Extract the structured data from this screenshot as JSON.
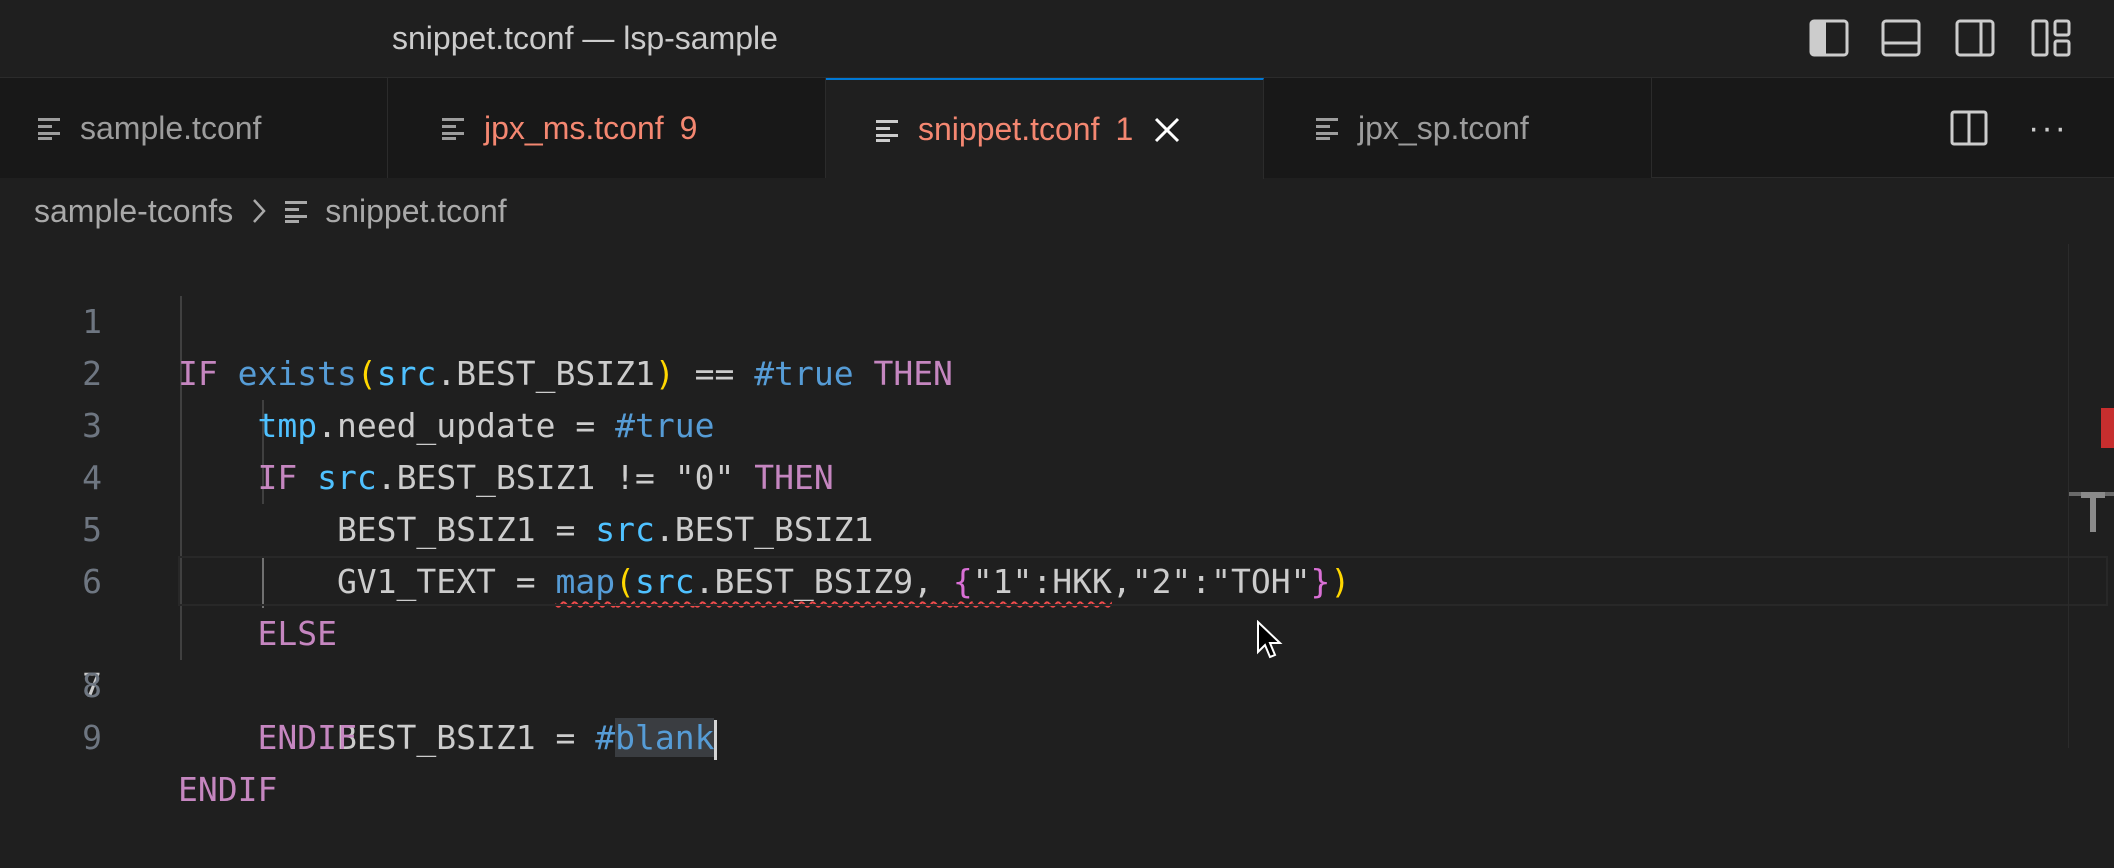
{
  "window": {
    "title": "snippet.tconf — lsp-sample"
  },
  "layout_controls": [
    {
      "name": "toggle-primary-sidebar",
      "icon": "sidebar-left-icon"
    },
    {
      "name": "toggle-panel",
      "icon": "panel-bottom-icon"
    },
    {
      "name": "toggle-secondary-sidebar",
      "icon": "sidebar-right-icon"
    },
    {
      "name": "customize-layout",
      "icon": "layout-icon"
    }
  ],
  "tabs": [
    {
      "label": "sample.tconf",
      "badge": "",
      "error": false,
      "active": false
    },
    {
      "label": "jpx_ms.tconf",
      "badge": "9",
      "error": true,
      "active": false
    },
    {
      "label": "snippet.tconf",
      "badge": "1",
      "error": true,
      "active": true
    },
    {
      "label": "jpx_sp.tconf",
      "badge": "",
      "error": false,
      "active": false
    }
  ],
  "tab_actions": {
    "split": "split-editor-icon",
    "more": "···"
  },
  "breadcrumb": {
    "folder": "sample-tconfs",
    "file": "snippet.tconf"
  },
  "editor": {
    "current_line": 7,
    "line_numbers": [
      "1",
      "2",
      "3",
      "4",
      "5",
      "6",
      "7",
      "8",
      "9"
    ]
  },
  "colors": {
    "accent": "#0078d4",
    "error": "#f48771",
    "keyword": "#c586c0",
    "variable": "#9cdcfe",
    "background": "#1f1f1f"
  }
}
